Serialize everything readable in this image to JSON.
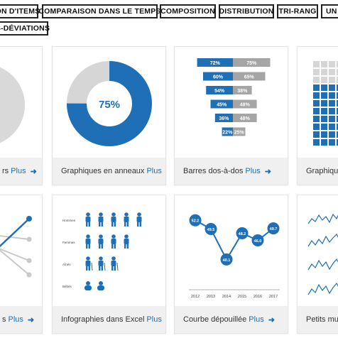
{
  "tabs": [
    "ON D'ITEMS",
    "COMPARAISON DANS LE TEMPS",
    "COMPOSITION",
    "DISTRIBUTION",
    "TRI-RANG",
    "UN",
    "S-DÉVIATIONS"
  ],
  "cards": [
    {
      "caption": "rs",
      "more": "Plus"
    },
    {
      "caption": "Graphiques en anneaux",
      "more": "Plus"
    },
    {
      "caption": "Barres dos-à-dos",
      "more": "Plus"
    },
    {
      "caption": "Graphiqu",
      "more": ""
    },
    {
      "caption": "s",
      "more": "Plus"
    },
    {
      "caption": "Infographies dans Excel",
      "more": "Plus"
    },
    {
      "caption": "Courbe dépouillée",
      "more": "Plus"
    },
    {
      "caption": "Petits mult",
      "more": ""
    }
  ],
  "donut": {
    "label": "75%",
    "value": 0.75
  },
  "backToBack": {
    "rows": [
      {
        "left": "72%",
        "right": "75%"
      },
      {
        "left": "60%",
        "right": "65%"
      },
      {
        "left": "54%",
        "right": "38%"
      },
      {
        "left": "45%",
        "right": "48%"
      },
      {
        "left": "36%",
        "right": "48%"
      },
      {
        "left": "22%",
        "right": "25%"
      }
    ]
  },
  "infographic": {
    "rows": [
      {
        "label": "Hommes",
        "count": 5,
        "icon": "person-icon"
      },
      {
        "label": "Femmes",
        "count": 4,
        "icon": "person-icon"
      },
      {
        "label": "Aînés",
        "count": 3,
        "icon": "elder-icon"
      },
      {
        "label": "Bébés",
        "count": 2,
        "icon": "baby-icon"
      }
    ]
  },
  "slope": {
    "years": [
      "2012",
      "2013",
      "2014",
      "2015",
      "2016",
      "2017"
    ],
    "values": [
      52.2,
      49.5,
      40.1,
      48.2,
      46.0,
      49.7
    ],
    "labels": [
      "52.2",
      "49.5",
      "40.1",
      "48.2",
      "46.0",
      "49.7"
    ]
  },
  "colors": {
    "accent": "#1f6fb6",
    "muted": "#d6d6d6",
    "gray": "#a5a5a5",
    "text": "#333333"
  },
  "icons": {
    "arrow": "arrow-right-icon"
  }
}
